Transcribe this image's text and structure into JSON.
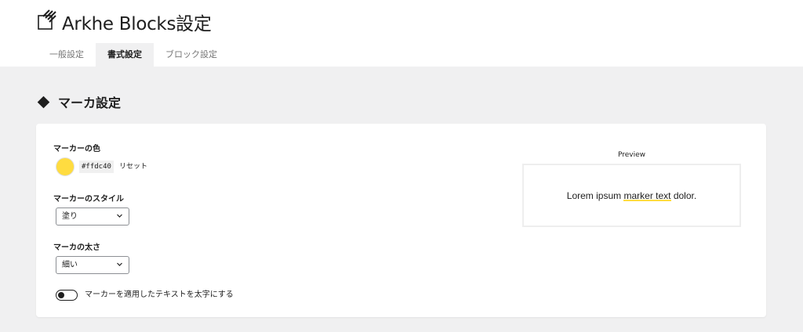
{
  "header": {
    "app_title": "Arkhe Blocks設定",
    "tabs": [
      {
        "label": "一般設定",
        "active": false
      },
      {
        "label": "書式設定",
        "active": true
      },
      {
        "label": "ブロック設定",
        "active": false
      }
    ]
  },
  "section": {
    "title": "マーカ設定"
  },
  "marker_color": {
    "label": "マーカーの色",
    "value": "#ffdc40",
    "code": "#ffdc40",
    "reset_label": "リセット"
  },
  "marker_style": {
    "label": "マーカーのスタイル",
    "value": "塗り"
  },
  "marker_thickness": {
    "label": "マーカの太さ",
    "value": "細い"
  },
  "bold_toggle": {
    "label": "マーカーを適用したテキストを太字にする",
    "checked": false
  },
  "preview": {
    "label": "Preview",
    "text_before": "Lorem ipsum ",
    "text_marked": "marker text",
    "text_after": " dolor."
  },
  "colors": {
    "page_background": "#f0f0f1",
    "card_background": "#ffffff",
    "marker": "#ffdc40",
    "text": "#1e1e1e"
  }
}
